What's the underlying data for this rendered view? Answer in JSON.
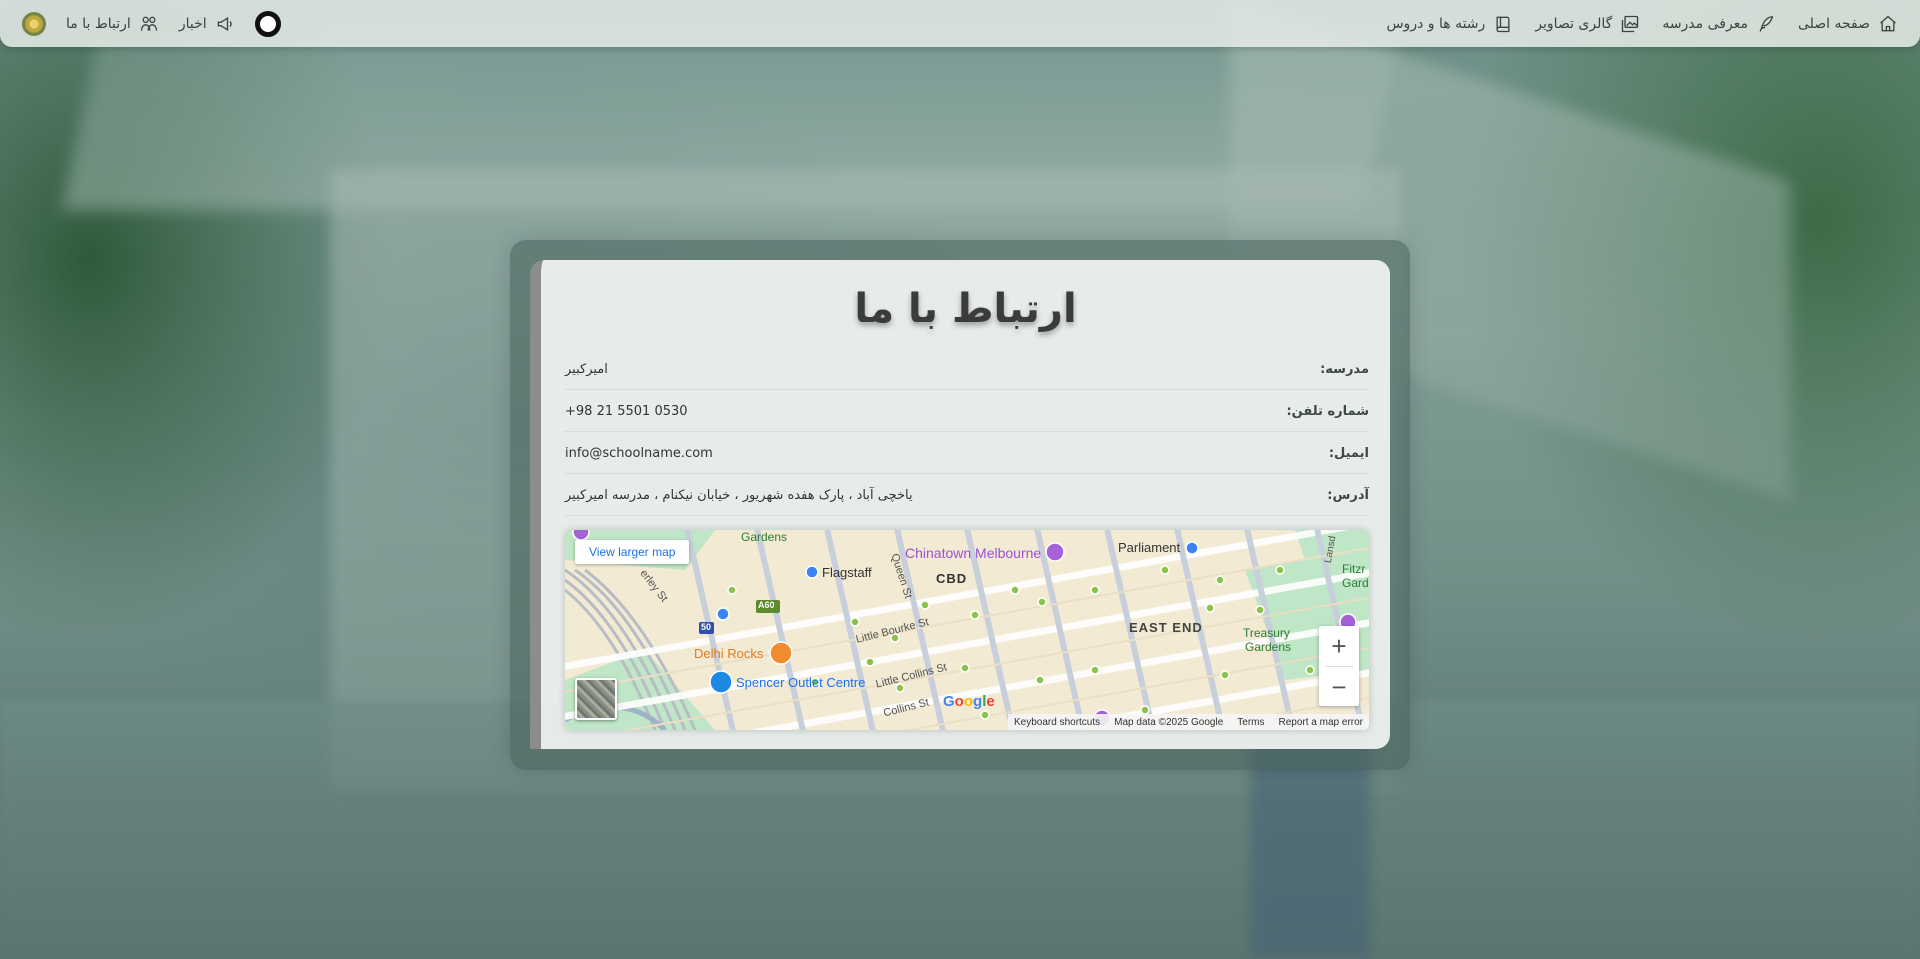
{
  "nav": {
    "right_items": [
      {
        "label": "صفحه اصلی",
        "icon": "home-icon"
      },
      {
        "label": "معرفی مدرسه",
        "icon": "quill-icon"
      },
      {
        "label": "گالری تصاویر",
        "icon": "gallery-icon"
      },
      {
        "label": "رشته ها و دروس",
        "icon": "book-icon"
      }
    ],
    "left_items": [
      {
        "label": "اخبار",
        "icon": "megaphone-icon"
      },
      {
        "label": "ارتباط با ما",
        "icon": "people-icon"
      }
    ],
    "theme_toggle": "theme-toggle",
    "logo": "school-logo"
  },
  "contact": {
    "title": "ارتباط با ما",
    "rows": [
      {
        "label": "مدرسه:",
        "value": "امیرکبیر"
      },
      {
        "label": "شماره تلفن:",
        "value": "+98 21 5501 0530"
      },
      {
        "label": "ایمیل:",
        "value": "info@schoolname.com"
      },
      {
        "label": "آدرس:",
        "value": "یاخچی آباد ، پارک هفده شهریور ، خیابان نیکنام ، مدرسه امیرکبیر"
      }
    ]
  },
  "map": {
    "view_larger": "View larger map",
    "zoom_in": "+",
    "zoom_out": "−",
    "labels": {
      "gardens": "Gardens",
      "flagstaff": "Flagstaff",
      "chinatown": "Chinatown Melbourne",
      "parliament": "Parliament",
      "cbd": "CBD",
      "queen_st": "Queen St",
      "a60": "A60",
      "little_bourke": "Little Bourke St",
      "east_end": "EAST END",
      "treasury": "Treasury",
      "treasury2": "Gardens",
      "fitzr": "Fitzr",
      "gard": "Gard",
      "delhi": "Delhi Rocks",
      "spencer": "Spencer Outlet Centre",
      "little_collins": "Little Collins St",
      "collins": "Collins St",
      "lansd": "Lansd",
      "erley": "erley St",
      "route50": "50"
    },
    "google_logo": "Google",
    "attribution": {
      "shortcuts": "Keyboard shortcuts",
      "data": "Map data ©2025 Google",
      "terms": "Terms",
      "report": "Report a map error"
    }
  },
  "colors": {
    "navbar_bg": "#e2e9e5",
    "card_bg": "#ecf0ee",
    "card_border": "#8c8c8c",
    "map_link": "#1a73e8"
  }
}
